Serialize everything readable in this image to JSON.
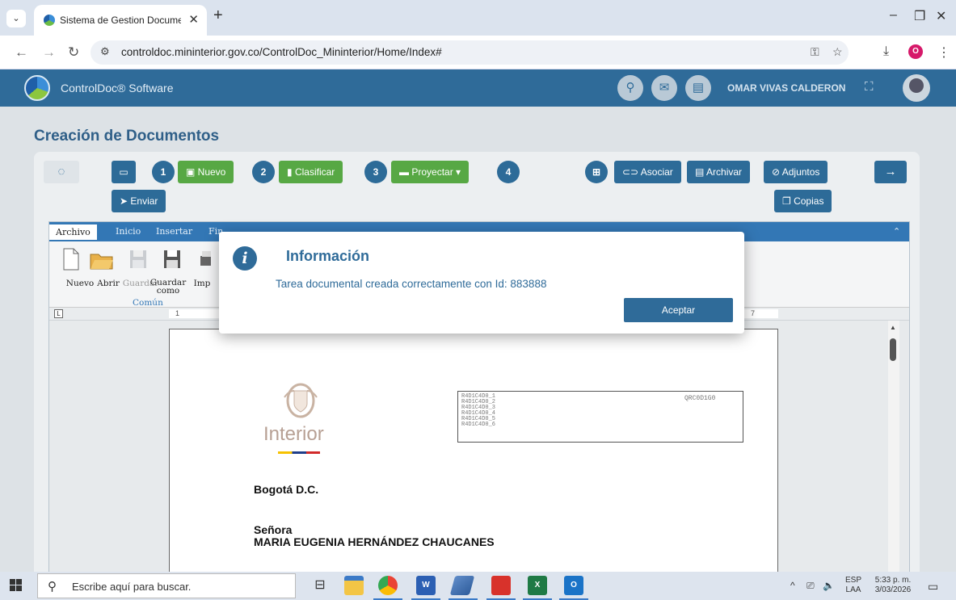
{
  "browser": {
    "tab_title": "Sistema de Gestion Documenta",
    "new_tab_symbol": "+",
    "url": "controldoc.mininterior.gov.co/ControlDoc_Mininterior/Home/Index#",
    "profile_initial": "O"
  },
  "app": {
    "name": "ControlDoc® Software",
    "user_name": "OMAR VIVAS CALDERON"
  },
  "page": {
    "title": "Creación de Documentos"
  },
  "toolbar": {
    "steps": [
      "1",
      "2",
      "3",
      "4"
    ],
    "nuevo": "Nuevo",
    "clasificar": "Clasificar",
    "proyectar": "Proyectar",
    "enviar": "Enviar",
    "asociar": "Asociar",
    "archivar": "Archivar",
    "adjuntos": "Adjuntos",
    "copias": "Copias"
  },
  "editor": {
    "ribbon_tabs": [
      "Archivo",
      "Inicio",
      "Insertar",
      "Fin"
    ],
    "ribbon_items": [
      "Nuevo",
      "Abrir",
      "Guardar",
      "Guardar como",
      "Imp"
    ],
    "group_label": "Común",
    "ruler_marks": [
      "1",
      "7"
    ],
    "document": {
      "logo_text": "Interior",
      "codes": [
        "R4D1C4D0_1",
        "R4D1C4D0_2",
        "R4D1C4D0_3",
        "R4D1C4D0_4",
        "R4D1C4D0_5",
        "R4D1C4D0_6"
      ],
      "qr_code": "QRC0D1G0",
      "city": "Bogotá D.C.",
      "salutation": "Señora",
      "recipient": "MARIA EUGENIA HERNÁNDEZ CHAUCANES"
    }
  },
  "modal": {
    "title": "Información",
    "message": "Tarea documental creada correctamente con Id: 883888",
    "button": "Aceptar"
  },
  "taskbar": {
    "search_placeholder": "Escribe aquí para buscar.",
    "lang_top": "ESP",
    "lang_bottom": "LAA",
    "time": "5:33 p. m.",
    "date": "3/03/2026"
  },
  "colors": {
    "header": "#2f6b99",
    "accent_green": "#57a844",
    "ribbon": "#3377b5"
  }
}
